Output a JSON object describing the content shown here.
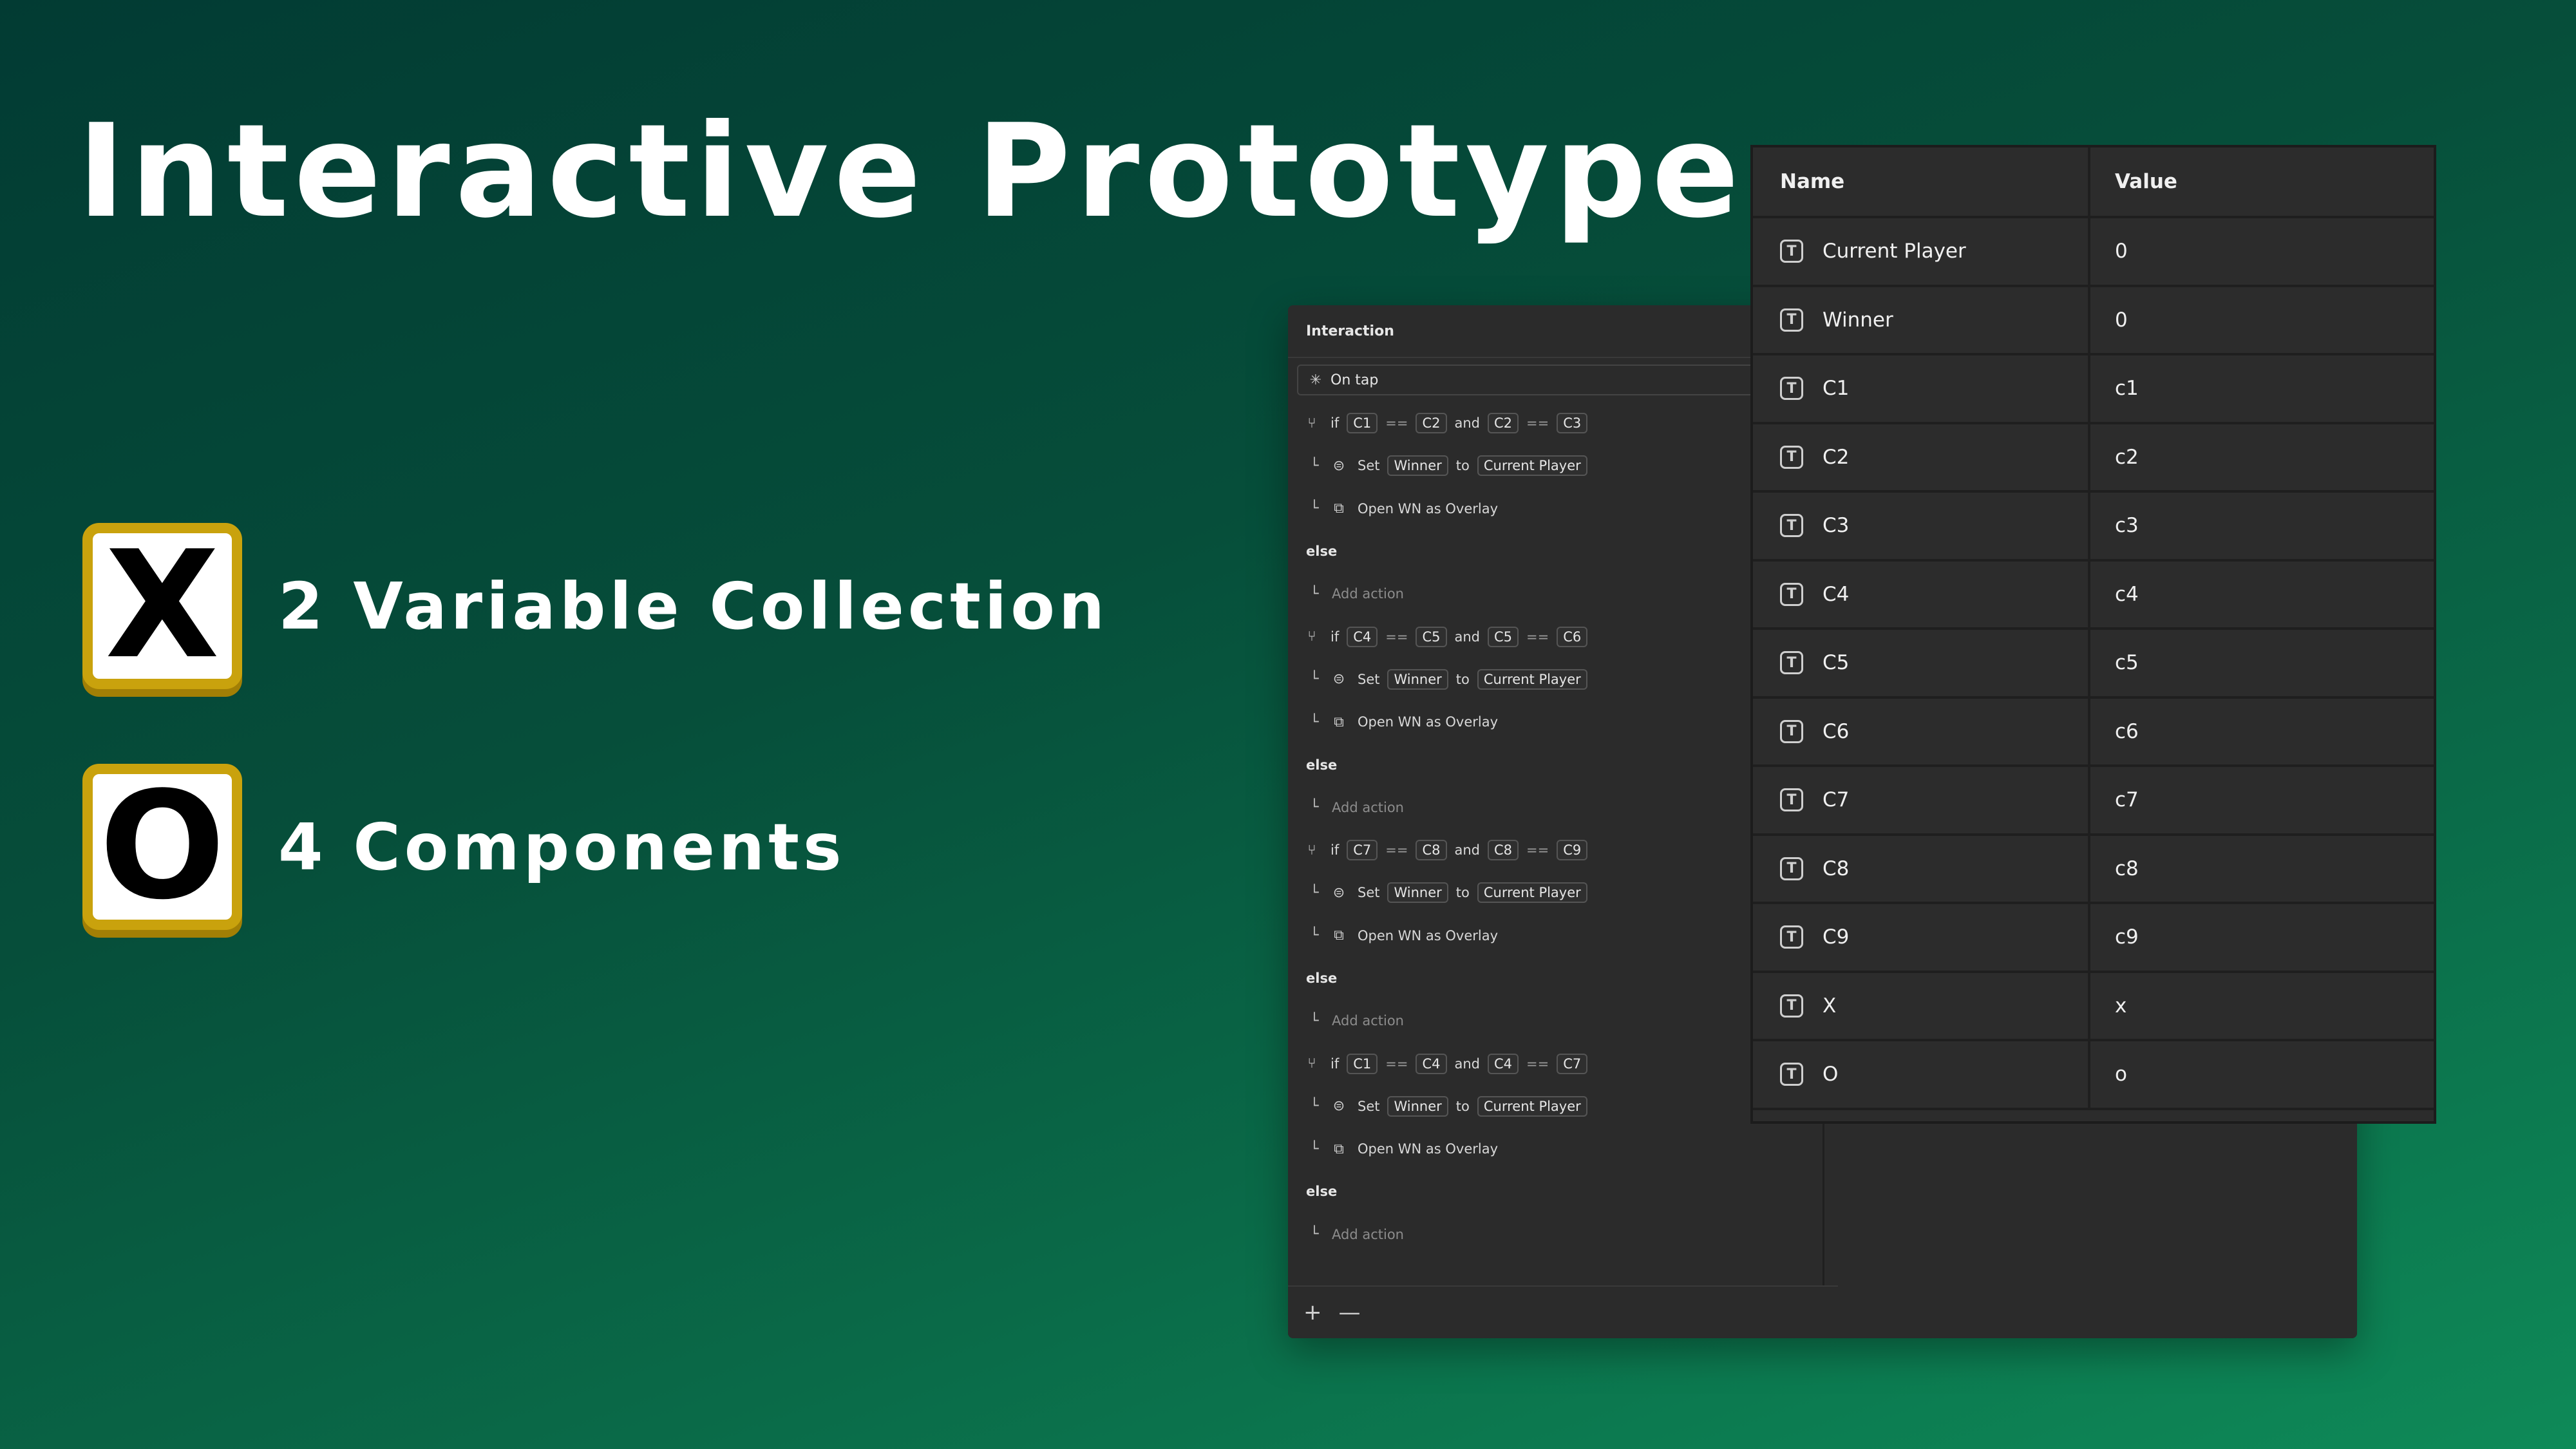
{
  "slide": {
    "title": "Interactive Prototype",
    "features": [
      {
        "badge": "X",
        "label": "2 Variable Collection",
        "icon": "x-badge-icon"
      },
      {
        "badge": "O",
        "label": "4 Components",
        "icon": "o-badge-icon"
      }
    ],
    "colors": {
      "accent_gold": "#c9a20d",
      "bg_dark": "#023b33",
      "bg_light": "#0e8a58"
    }
  },
  "interaction_panel": {
    "header": "Interaction",
    "trigger": "On tap",
    "if_kw": "if",
    "and_kw": "and",
    "eq_op": "==",
    "else_kw": "else",
    "set_kw": "Set",
    "to_kw": "to",
    "add_action": "Add action",
    "blocks": [
      {
        "a": "C1",
        "b": "C2",
        "c": "C2",
        "d": "C3",
        "var": "Winner",
        "value": "Current Player",
        "open": "Open WN as Overlay"
      },
      {
        "a": "C4",
        "b": "C5",
        "c": "C5",
        "d": "C6",
        "var": "Winner",
        "value": "Current Player",
        "open": "Open WN as Overlay"
      },
      {
        "a": "C7",
        "b": "C8",
        "c": "C8",
        "d": "C9",
        "var": "Winner",
        "value": "Current Player",
        "open": "Open WN as Overlay"
      },
      {
        "a": "C1",
        "b": "C4",
        "c": "C4",
        "d": "C7",
        "var": "Winner",
        "value": "Current Player",
        "open": "Open WN as Overlay"
      }
    ],
    "footer": {
      "add": "+",
      "remove": "—"
    }
  },
  "variables_table": {
    "columns": {
      "name": "Name",
      "value": "Value"
    },
    "rows": [
      {
        "name": "Current Player",
        "value": "0"
      },
      {
        "name": "Winner",
        "value": "0"
      },
      {
        "name": "C1",
        "value": "c1"
      },
      {
        "name": "C2",
        "value": "c2"
      },
      {
        "name": "C3",
        "value": "c3"
      },
      {
        "name": "C4",
        "value": "c4"
      },
      {
        "name": "C5",
        "value": "c5"
      },
      {
        "name": "C6",
        "value": "c6"
      },
      {
        "name": "C7",
        "value": "c7"
      },
      {
        "name": "C8",
        "value": "c8"
      },
      {
        "name": "C9",
        "value": "c9"
      },
      {
        "name": "X",
        "value": "x"
      },
      {
        "name": "O",
        "value": "o"
      }
    ]
  }
}
